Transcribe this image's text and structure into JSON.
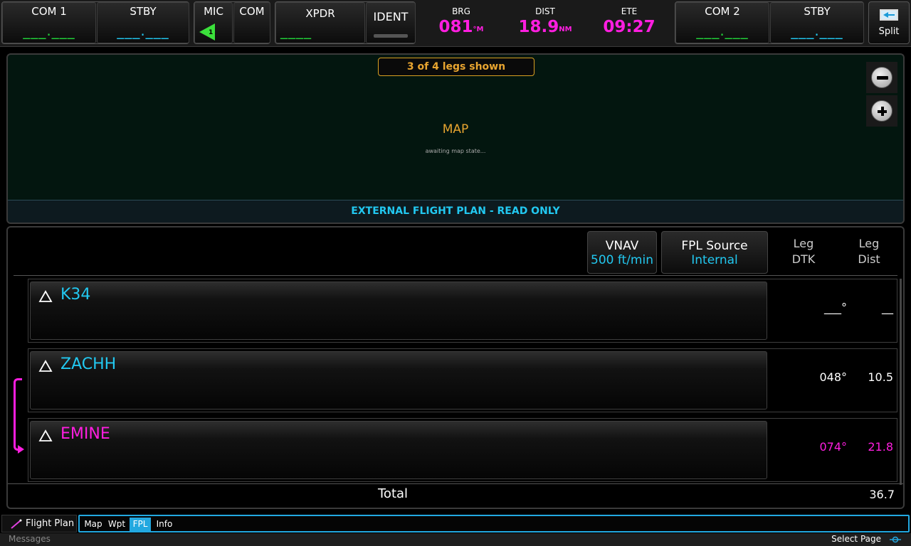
{
  "topbar": {
    "com1": {
      "label": "COM 1",
      "active": "___.___",
      "standby_label": "STBY",
      "standby": "___.___"
    },
    "mic": {
      "label": "MIC",
      "number": "1",
      "com_label": "COM"
    },
    "xpdr": {
      "label": "XPDR",
      "code": "____",
      "ident_label": "IDENT"
    },
    "nav": {
      "brg_label": "BRG",
      "brg_value": "081",
      "brg_unit": "°M",
      "dist_label": "DIST",
      "dist_value": "18.9",
      "dist_unit": "NM",
      "ete_label": "ETE",
      "ete_value": "09:27"
    },
    "com2": {
      "label": "COM 2",
      "active": "___.___",
      "standby_label": "STBY",
      "standby": "___.___"
    },
    "split_label": "Split"
  },
  "map": {
    "legs_shown": "3 of 4 legs shown",
    "title": "MAP",
    "status": "awaiting map state...",
    "banner": "EXTERNAL FLIGHT PLAN - READ ONLY"
  },
  "fpl": {
    "vnav": {
      "label": "VNAV",
      "value": "500 ft/min"
    },
    "source": {
      "label": "FPL Source",
      "value": "Internal"
    },
    "col_dtk": [
      "Leg",
      "DTK"
    ],
    "col_dist": [
      "Leg",
      "Dist"
    ],
    "rows": [
      {
        "ident": "K34",
        "dtk": "___°",
        "dist": "__",
        "color": "#22c8f0"
      },
      {
        "ident": "ZACHH",
        "dtk": "048°",
        "dist": "10.5",
        "color": "#22c8f0"
      },
      {
        "ident": "EMINE",
        "dtk": "074°",
        "dist": "21.8",
        "color": "#ff1ee0"
      }
    ],
    "total_label": "Total",
    "total_value": "36.7",
    "active_leg_color": "#ff1ee0"
  },
  "bottombar": {
    "app_label": "Flight Plan",
    "tabs": [
      "Map",
      "Wpt",
      "FPL",
      "Info"
    ],
    "active_tab": "FPL",
    "messages": "Messages",
    "select_page": "Select Page"
  }
}
